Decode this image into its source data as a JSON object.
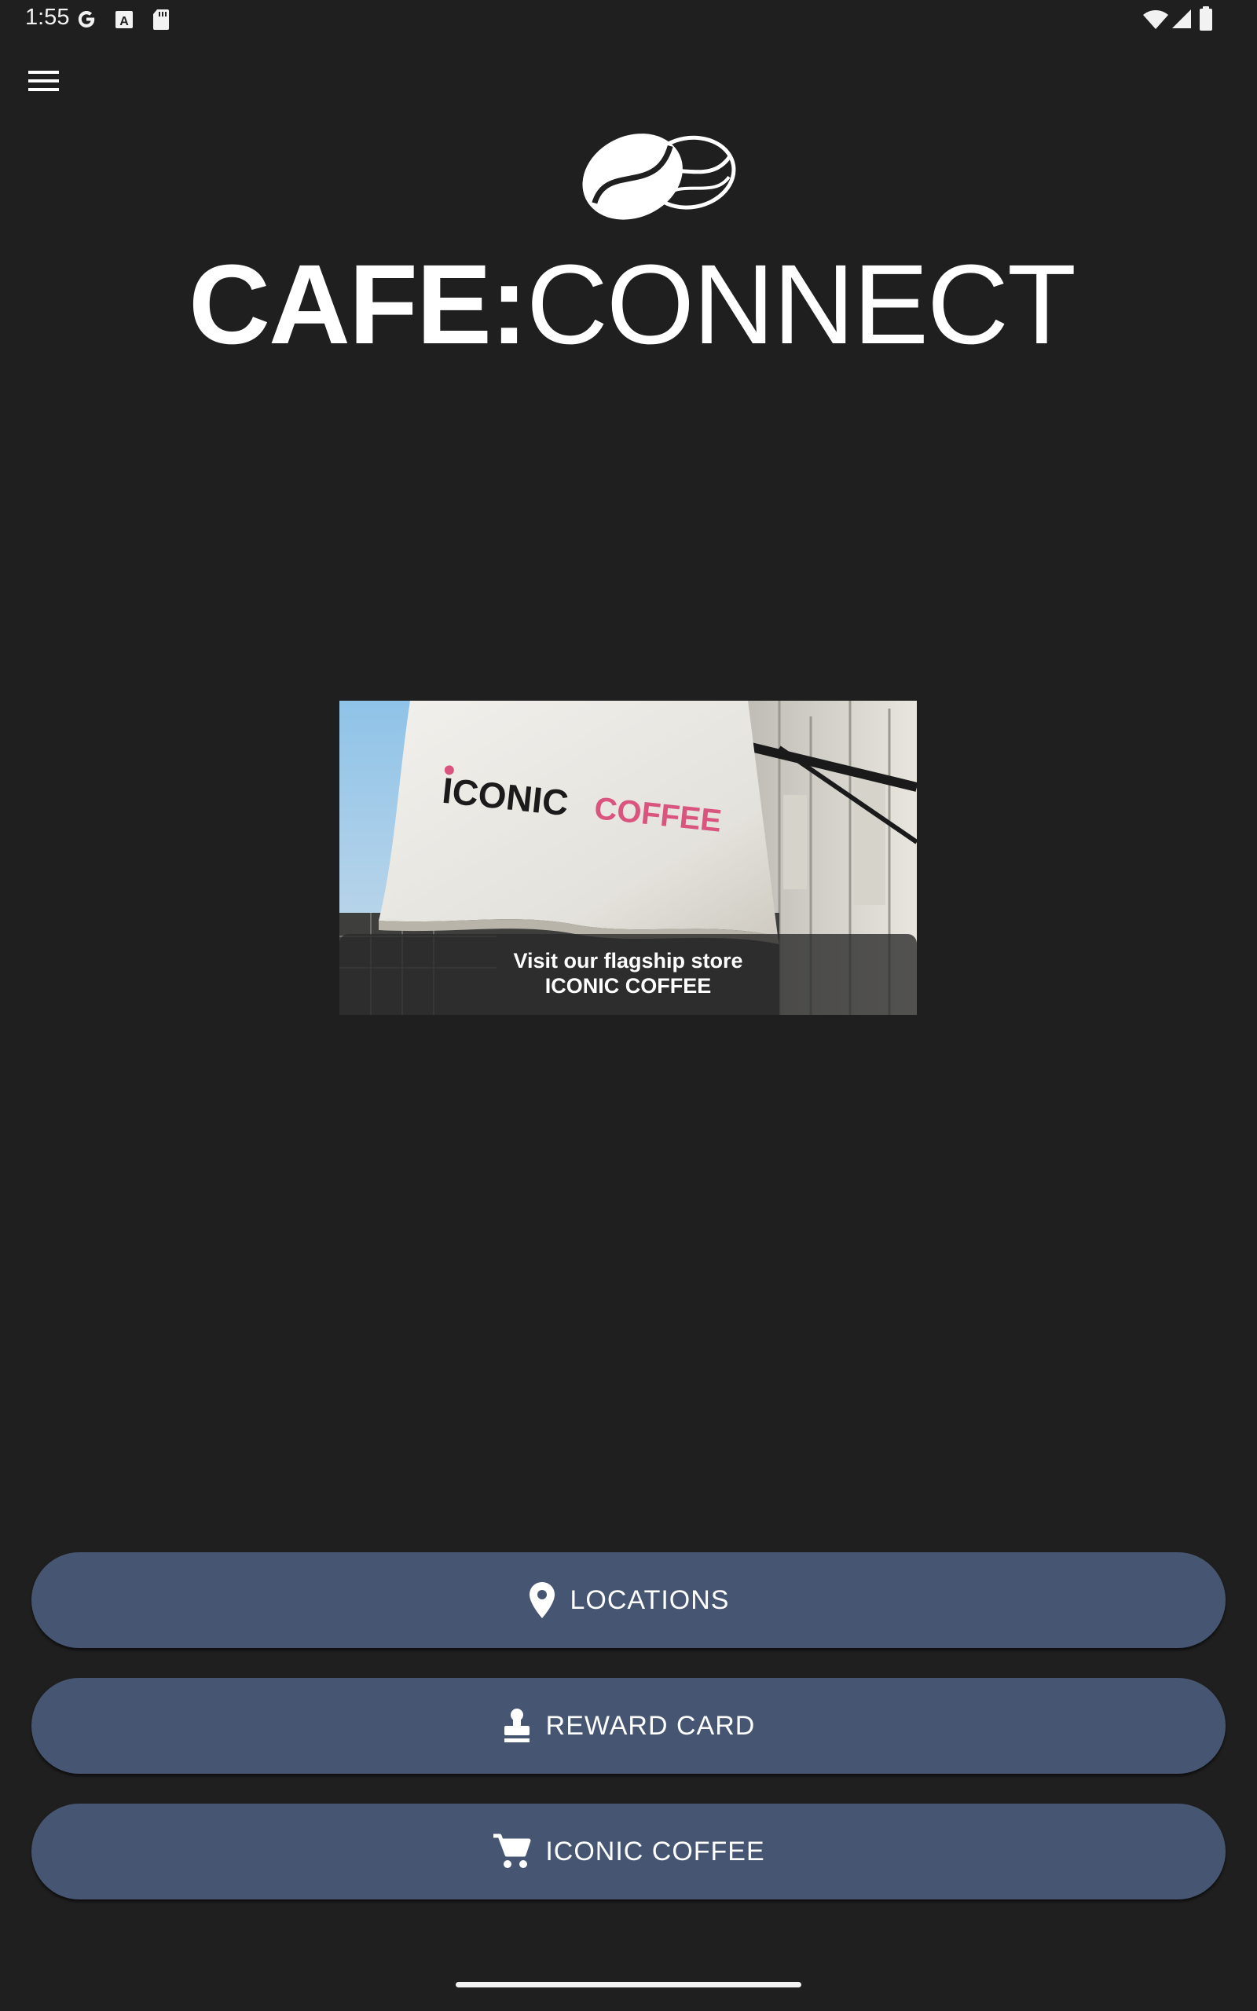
{
  "status_bar": {
    "time": "1:55",
    "left_icons": [
      "google-icon",
      "font-a-icon",
      "sd-card-icon"
    ],
    "right_icons": [
      "wifi-icon",
      "cellular-signal-icon",
      "battery-icon"
    ]
  },
  "header": {
    "menu_icon": "hamburger-menu-icon",
    "logo_icon": "coffee-beans-icon",
    "logo_text_bold": "CAFE:",
    "logo_text_light": "CONNECT"
  },
  "promo": {
    "banner_text_black": "ICONIC",
    "banner_text_pink": "COFFEE",
    "caption_line1": "Visit our flagship store",
    "caption_line2": "ICONIC COFFEE"
  },
  "buttons": {
    "locations": {
      "label": "LOCATIONS",
      "icon": "location-pin-icon"
    },
    "reward": {
      "label": "REWARD CARD",
      "icon": "stamp-icon"
    },
    "iconic": {
      "label": "ICONIC COFFEE",
      "icon": "shopping-cart-icon"
    }
  },
  "colors": {
    "background": "#1f1f1f",
    "button_fill": "#465571",
    "banner_pink": "#d9547f"
  }
}
